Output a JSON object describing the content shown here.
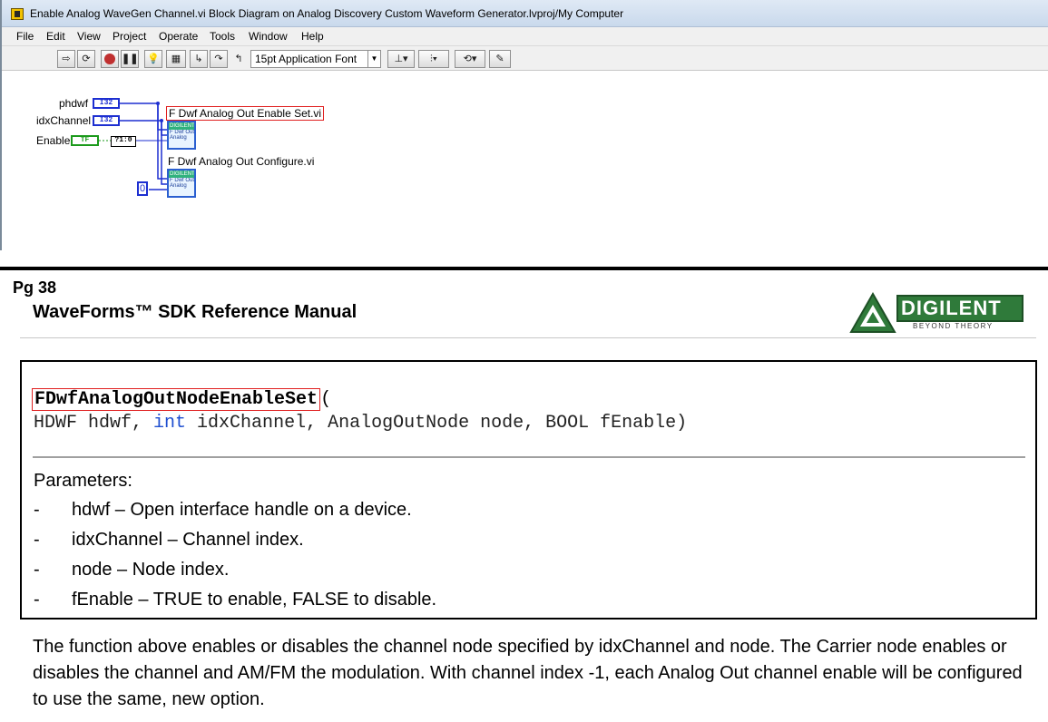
{
  "window": {
    "title": "Enable Analog WaveGen Channel.vi Block Diagram on Analog Discovery Custom Waveform Generator.lvproj/My Computer"
  },
  "menu": [
    "File",
    "Edit",
    "View",
    "Project",
    "Operate",
    "Tools",
    "Window",
    "Help"
  ],
  "toolbar": {
    "font_select": "15pt Application Font",
    "icons": [
      "run-arrow-icon",
      "run-continuous-icon",
      "abort-icon",
      "pause-icon",
      "highlight-execution-icon",
      "retain-wire-values-icon",
      "step-into-icon",
      "step-over-icon",
      "step-out-icon",
      "align-objects-icon",
      "distribute-objects-icon",
      "reorder-icon",
      "cleanup-diagram-icon"
    ]
  },
  "diagram": {
    "inputs": [
      {
        "label": "phdwf",
        "type": "I32"
      },
      {
        "label": "idxChannel",
        "type": "I32"
      },
      {
        "label": "Enable",
        "type": "TF"
      }
    ],
    "convert_label": "?1:0",
    "subvi_1": {
      "label": "F Dwf Analog Out Enable Set.vi",
      "icon_top": "DIGILENT",
      "icon_body": "F Dwf Out Analog"
    },
    "subvi_2": {
      "label": "F Dwf Analog Out Configure.vi",
      "icon_top": "DIGILENT",
      "icon_body": "F Dwf Out Analog"
    },
    "constant": "0"
  },
  "document": {
    "page_num": "Pg 38",
    "title": "WaveForms™ SDK Reference Manual",
    "logo": {
      "text": "DIGILENT",
      "tagline": "BEYOND THEORY"
    },
    "function": {
      "name": "FDwfAnalogOutNodeEnableSet",
      "open_paren": "(",
      "sig_prefix": "HDWF hdwf, ",
      "sig_int": "int",
      "sig_suffix": " idxChannel, AnalogOutNode node, BOOL fEnable)"
    },
    "params_title": "Parameters:",
    "params": [
      "hdwf – Open interface handle on a device.",
      "idxChannel – Channel index.",
      "node – Node index.",
      "fEnable – TRUE to enable, FALSE to disable."
    ],
    "dash": "-",
    "paragraph": "The function above enables or disables the channel node specified by idxChannel and node. The Carrier node enables or disables the channel and AM/FM the modulation. With channel index -1, each Analog Out channel enable will be configured to use the same, new option."
  }
}
